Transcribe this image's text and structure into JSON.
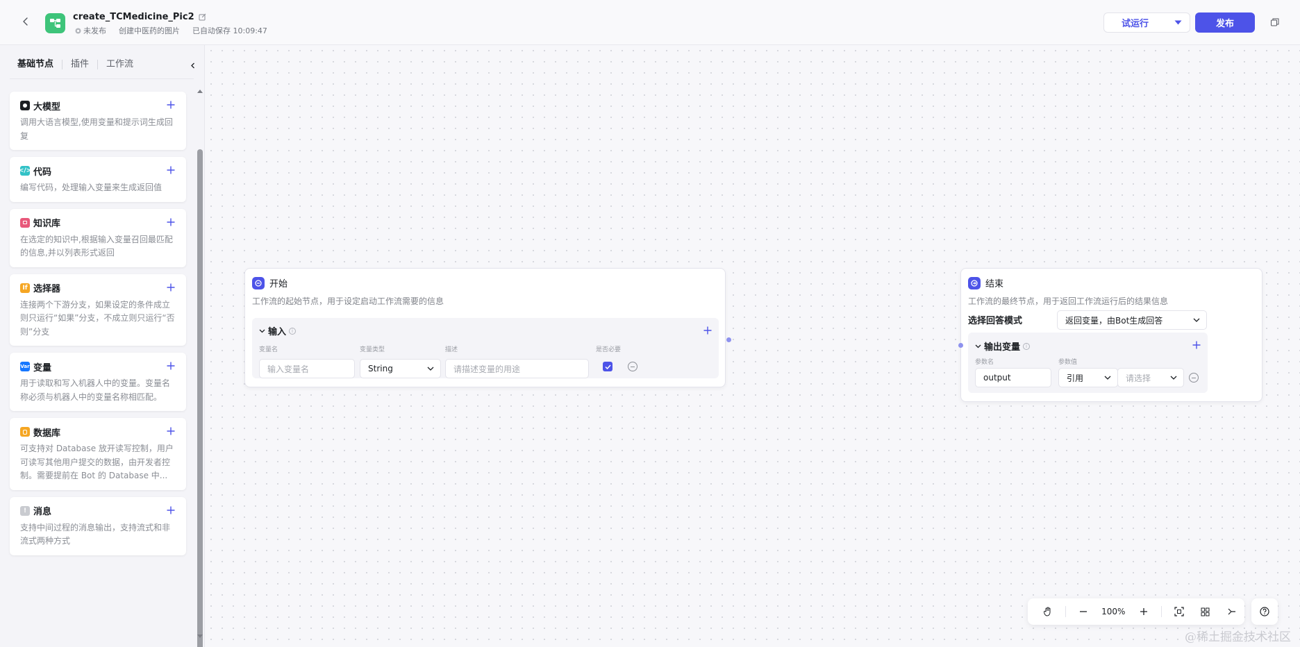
{
  "header": {
    "title": "create_TCMedicine_Pic2",
    "status": "未发布",
    "description": "创建中医药的图片",
    "autosave": "已自动保存 10:09:47",
    "test_run_label": "试运行",
    "publish_label": "发布"
  },
  "sidebar": {
    "tabs": [
      "基础节点",
      "插件",
      "工作流"
    ],
    "nodes": [
      {
        "title": "大模型",
        "desc": "调用大语言模型,使用变量和提示词生成回复",
        "icon": "llm-icon",
        "color": "#1c1f23"
      },
      {
        "title": "代码",
        "desc": "编写代码，处理输入变量来生成返回值",
        "icon": "code-icon",
        "color": "#33c2c7"
      },
      {
        "title": "知识库",
        "desc": "在选定的知识中,根据输入变量召回最匹配的信息,并以列表形式返回",
        "icon": "knowledge-icon",
        "color": "#e8587a"
      },
      {
        "title": "选择器",
        "desc": "连接两个下游分支，如果设定的条件成立则只运行“如果”分支，不成立则只运行“否则”分支",
        "icon": "if-icon",
        "color": "#f5a623"
      },
      {
        "title": "变量",
        "desc": "用于读取和写入机器人中的变量。变量名称必须与机器人中的变量名称相匹配。",
        "icon": "variable-icon",
        "color": "#1677ff"
      },
      {
        "title": "数据库",
        "desc": "可支持对 Database 放开读写控制，用户可读写其他用户提交的数据，由开发者控制。需要提前在 Bot 的 Database 中...",
        "icon": "database-icon",
        "color": "#f5a623"
      },
      {
        "title": "消息",
        "desc": "支持中间过程的消息输出，支持流式和非流式两种方式",
        "icon": "message-icon",
        "color": "#c9cbd0"
      }
    ]
  },
  "start_node": {
    "title": "开始",
    "desc": "工作流的起始节点，用于设定启动工作流需要的信息",
    "input_section": "输入",
    "col_name": "变量名",
    "col_type": "变量类型",
    "col_desc": "描述",
    "col_required": "是否必要",
    "name_placeholder": "输入变量名",
    "type_value": "String",
    "desc_placeholder": "请描述变量的用途"
  },
  "end_node": {
    "title": "结束",
    "desc": "工作流的最终节点，用于返回工作流运行后的结果信息",
    "mode_label": "选择回答模式",
    "mode_value": "返回变量，由Bot生成回答",
    "output_section": "输出变量",
    "col_param_name": "参数名",
    "col_param_value": "参数值",
    "param_name": "output",
    "ref_value": "引用",
    "select_placeholder": "请选择"
  },
  "toolbar": {
    "zoom": "100%"
  },
  "watermark": "@稀土掘金技术社区"
}
